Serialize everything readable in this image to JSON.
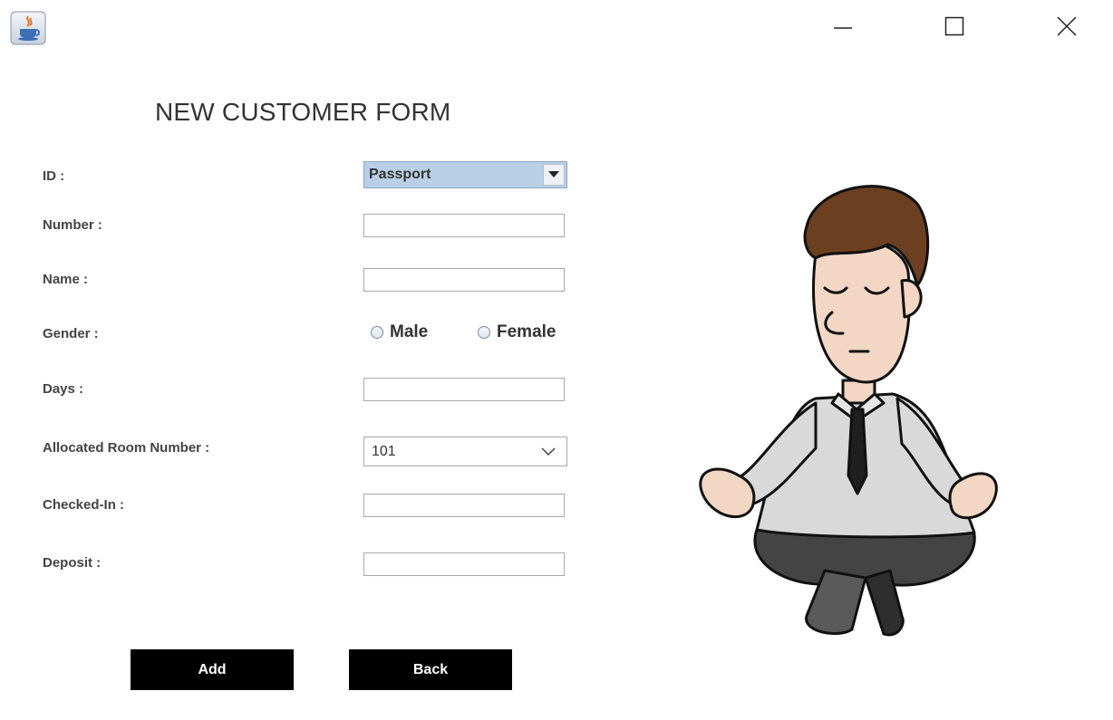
{
  "window": {
    "icons": [
      "java-app-icon",
      "minimize-icon",
      "maximize-icon",
      "close-icon"
    ]
  },
  "form": {
    "title": "NEW CUSTOMER FORM",
    "fields": {
      "id": {
        "label": "ID :",
        "value": "Passport"
      },
      "number": {
        "label": "Number :",
        "value": ""
      },
      "name": {
        "label": "Name :",
        "value": ""
      },
      "gender": {
        "label": "Gender :",
        "options": [
          "Male",
          "Female"
        ]
      },
      "days": {
        "label": "Days :",
        "value": ""
      },
      "room": {
        "label": "Allocated Room Number :",
        "value": "101"
      },
      "checked_in": {
        "label": "Checked-In :",
        "value": ""
      },
      "deposit": {
        "label": "Deposit :",
        "value": ""
      }
    },
    "buttons": {
      "add": "Add",
      "back": "Back"
    }
  },
  "colors": {
    "combo_selected_bg": "#b8cfe5",
    "button_bg": "#000000",
    "button_text": "#ffffff"
  }
}
